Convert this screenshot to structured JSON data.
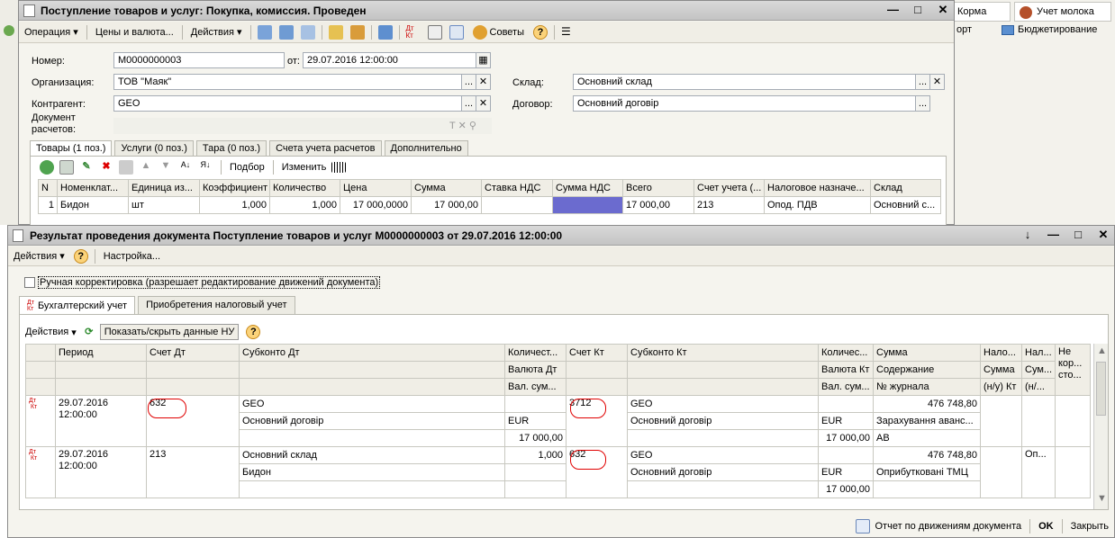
{
  "bg_app": {
    "right_tab1": "Корма",
    "right_tab2": "Учет молока",
    "right_item1": "орт",
    "right_item2": "Бюджетирование"
  },
  "doc": {
    "title": "Поступление товаров и услуг: Покупка, комиссия. Проведен",
    "toolbar": {
      "operation": "Операция",
      "prices": "Цены и валюта...",
      "actions": "Действия",
      "tips": "Советы"
    },
    "number_label": "Номер:",
    "number_value": "М0000000003",
    "date_label": "от:",
    "date_value": "29.07.2016 12:00:00",
    "org_label": "Организация:",
    "org_value": "ТОВ \"Маяк\"",
    "warehouse_label": "Склад:",
    "warehouse_value": "Основний склад",
    "counterparty_label": "Контрагент:",
    "counterparty_value": "GEO",
    "contract_label": "Договор:",
    "contract_value": "Основний договір",
    "payment_doc_label1": "Документ",
    "payment_doc_label2": "расчетов:",
    "tabs": [
      "Товары (1 поз.)",
      "Услуги (0 поз.)",
      "Тара (0 поз.)",
      "Счета учета расчетов",
      "Дополнительно"
    ],
    "grid_toolbar": {
      "select": "Подбор",
      "change": "Изменить"
    },
    "columns": [
      "N",
      "Номенклат...",
      "Единица из...",
      "Коэффициент",
      "Количество",
      "Цена",
      "Сумма",
      "Ставка НДС",
      "Сумма НДС",
      "Всего",
      "Счет учета (...",
      "Налоговое назначе...",
      "Склад"
    ],
    "rows": [
      [
        "1",
        "Бидон",
        "шт",
        "1,000",
        "1,000",
        "17 000,0000",
        "17 000,00",
        "",
        "",
        "17 000,00",
        "213",
        "Опод. ПДВ",
        "Основний с..."
      ]
    ]
  },
  "result": {
    "title": "Результат проведения документа Поступление товаров и услуг М0000000003 от 29.07.2016 12:00:00",
    "toolbar": {
      "actions": "Действия",
      "settings": "Настройка..."
    },
    "manual_checkbox": "Ручная корректировка (разрешает редактирование движений документа)",
    "tabs": [
      "Бухгалтерский учет",
      "Приобретения налоговый учет"
    ],
    "inner_toolbar": {
      "actions": "Действия",
      "toggle": "Показать/скрыть данные НУ"
    },
    "header": {
      "period": "Период",
      "debit": "Счет Дт",
      "sub_dt": "Субконто Дт",
      "qty_dt": "Количест...",
      "cur_dt": "Валюта Дт",
      "valsum_dt": "Вал. сум...",
      "credit": "Счет Кт",
      "sub_kt": "Субконто Кт",
      "qty_kt": "Количес...",
      "cur_kt": "Валюта Кт",
      "valsum_kt": "Вал. сум...",
      "sum": "Сумма",
      "content": "Содержание",
      "journal": "№ журнала",
      "tax1": "Нало...",
      "tax1b": "Сумма",
      "tax1c": "(н/у) Кт",
      "tax2": "Нал...",
      "tax2b": "Сум...",
      "tax2c": "(н/...",
      "tax3a": "Не",
      "tax3b": "кор...",
      "tax3c": "сто..."
    },
    "rows": [
      {
        "period1": "29.07.2016",
        "period2": "12:00:00",
        "debit": "632",
        "sub_dt1": "GEO",
        "sub_dt2": "Основний договір",
        "qty_dt": "",
        "cur_dt": "EUR",
        "valsum_dt": "17 000,00",
        "credit": "3712",
        "sub_kt1": "GEO",
        "sub_kt2": "Основний договір",
        "qty_kt": "",
        "cur_kt": "EUR",
        "valsum_kt": "17 000,00",
        "sum": "476 748,80",
        "content": "Зарахування аванс...",
        "journal": "АВ",
        "tax2": ""
      },
      {
        "period1": "29.07.2016",
        "period2": "12:00:00",
        "debit": "213",
        "sub_dt1": "Основний склад",
        "sub_dt2": "Бидон",
        "qty_dt": "1,000",
        "cur_dt": "",
        "valsum_dt": "",
        "credit": "632",
        "sub_kt1": "GEO",
        "sub_kt2": "Основний договір",
        "qty_kt": "",
        "cur_kt": "EUR",
        "valsum_kt": "17 000,00",
        "sum": "476 748,80",
        "content": "Оприбутковані ТМЦ",
        "journal": "",
        "tax2": "Оп..."
      }
    ],
    "footer": {
      "report": "Отчет по движениям документа",
      "ok": "OK",
      "close": "Закрыть"
    }
  }
}
